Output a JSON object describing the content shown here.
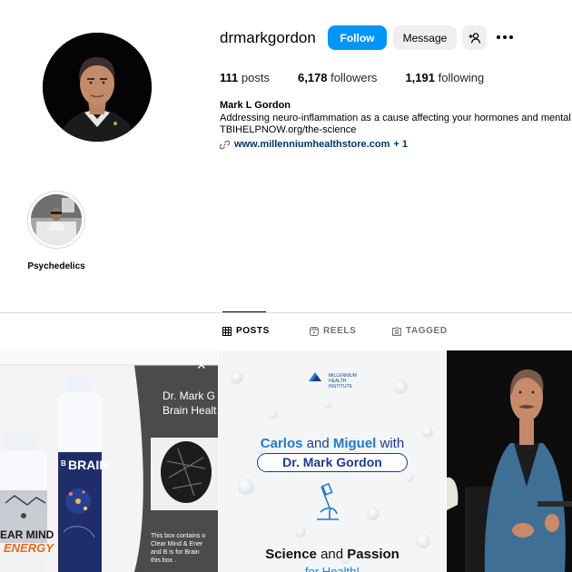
{
  "profile": {
    "username": "drmarkgordon",
    "follow_label": "Follow",
    "message_label": "Message",
    "add_user_icon": "person-add-icon",
    "more_icon": "more-horizontal-icon",
    "stats": {
      "posts_count": "111",
      "posts_label": "posts",
      "followers_count": "6,178",
      "followers_label": "followers",
      "following_count": "1,191",
      "following_label": "following"
    },
    "full_name": "Mark L Gordon",
    "bio_line1": "Addressing neuro-inflammation as a cause affecting your hormones and mental",
    "bio_line2": "TBIHELPNOW.org/the-science",
    "link_text": "www.millenniumhealthstore.com",
    "link_more": "+ 1",
    "link_icon": "link-chain-icon"
  },
  "highlights": [
    {
      "label": "Psychedelics"
    }
  ],
  "tabs": [
    {
      "label": "POSTS",
      "icon": "grid-icon",
      "active": true
    },
    {
      "label": "REELS",
      "icon": "reels-icon",
      "active": false
    },
    {
      "label": "TAGGED",
      "icon": "tagged-icon",
      "active": false
    }
  ],
  "posts": {
    "post1": {
      "title_line1": "Dr. Mark G",
      "title_line2": "Brain Healt",
      "small_line1": "This box contains o",
      "small_line2": "Clear Mind & Ener",
      "small_line3": "and B is for Brain",
      "small_line4": "this box .",
      "bottle_brain": "BRAIN",
      "bottle_brain_prefix": "B",
      "bottle_clear": "EAR MIND",
      "bottle_energy": "ENERGY"
    },
    "post2": {
      "logo_text1": "MILLENNIUM",
      "logo_text2": "HEALTH",
      "logo_text3": "INSTITUTE",
      "line1_a": "Carlos",
      "line1_b": "and",
      "line1_c": "Miguel",
      "line1_d": "with",
      "pill": "Dr. Mark Gordon",
      "line2_a": "Science",
      "line2_b": "and",
      "line2_c": "Passion",
      "line3": "for Health!"
    }
  },
  "colors": {
    "follow_blue": "#0095f6",
    "link_blue": "#00376b",
    "divider": "#dbdbdb",
    "post_navy": "#1e3a8a",
    "post_sky": "#1f7ac8"
  }
}
